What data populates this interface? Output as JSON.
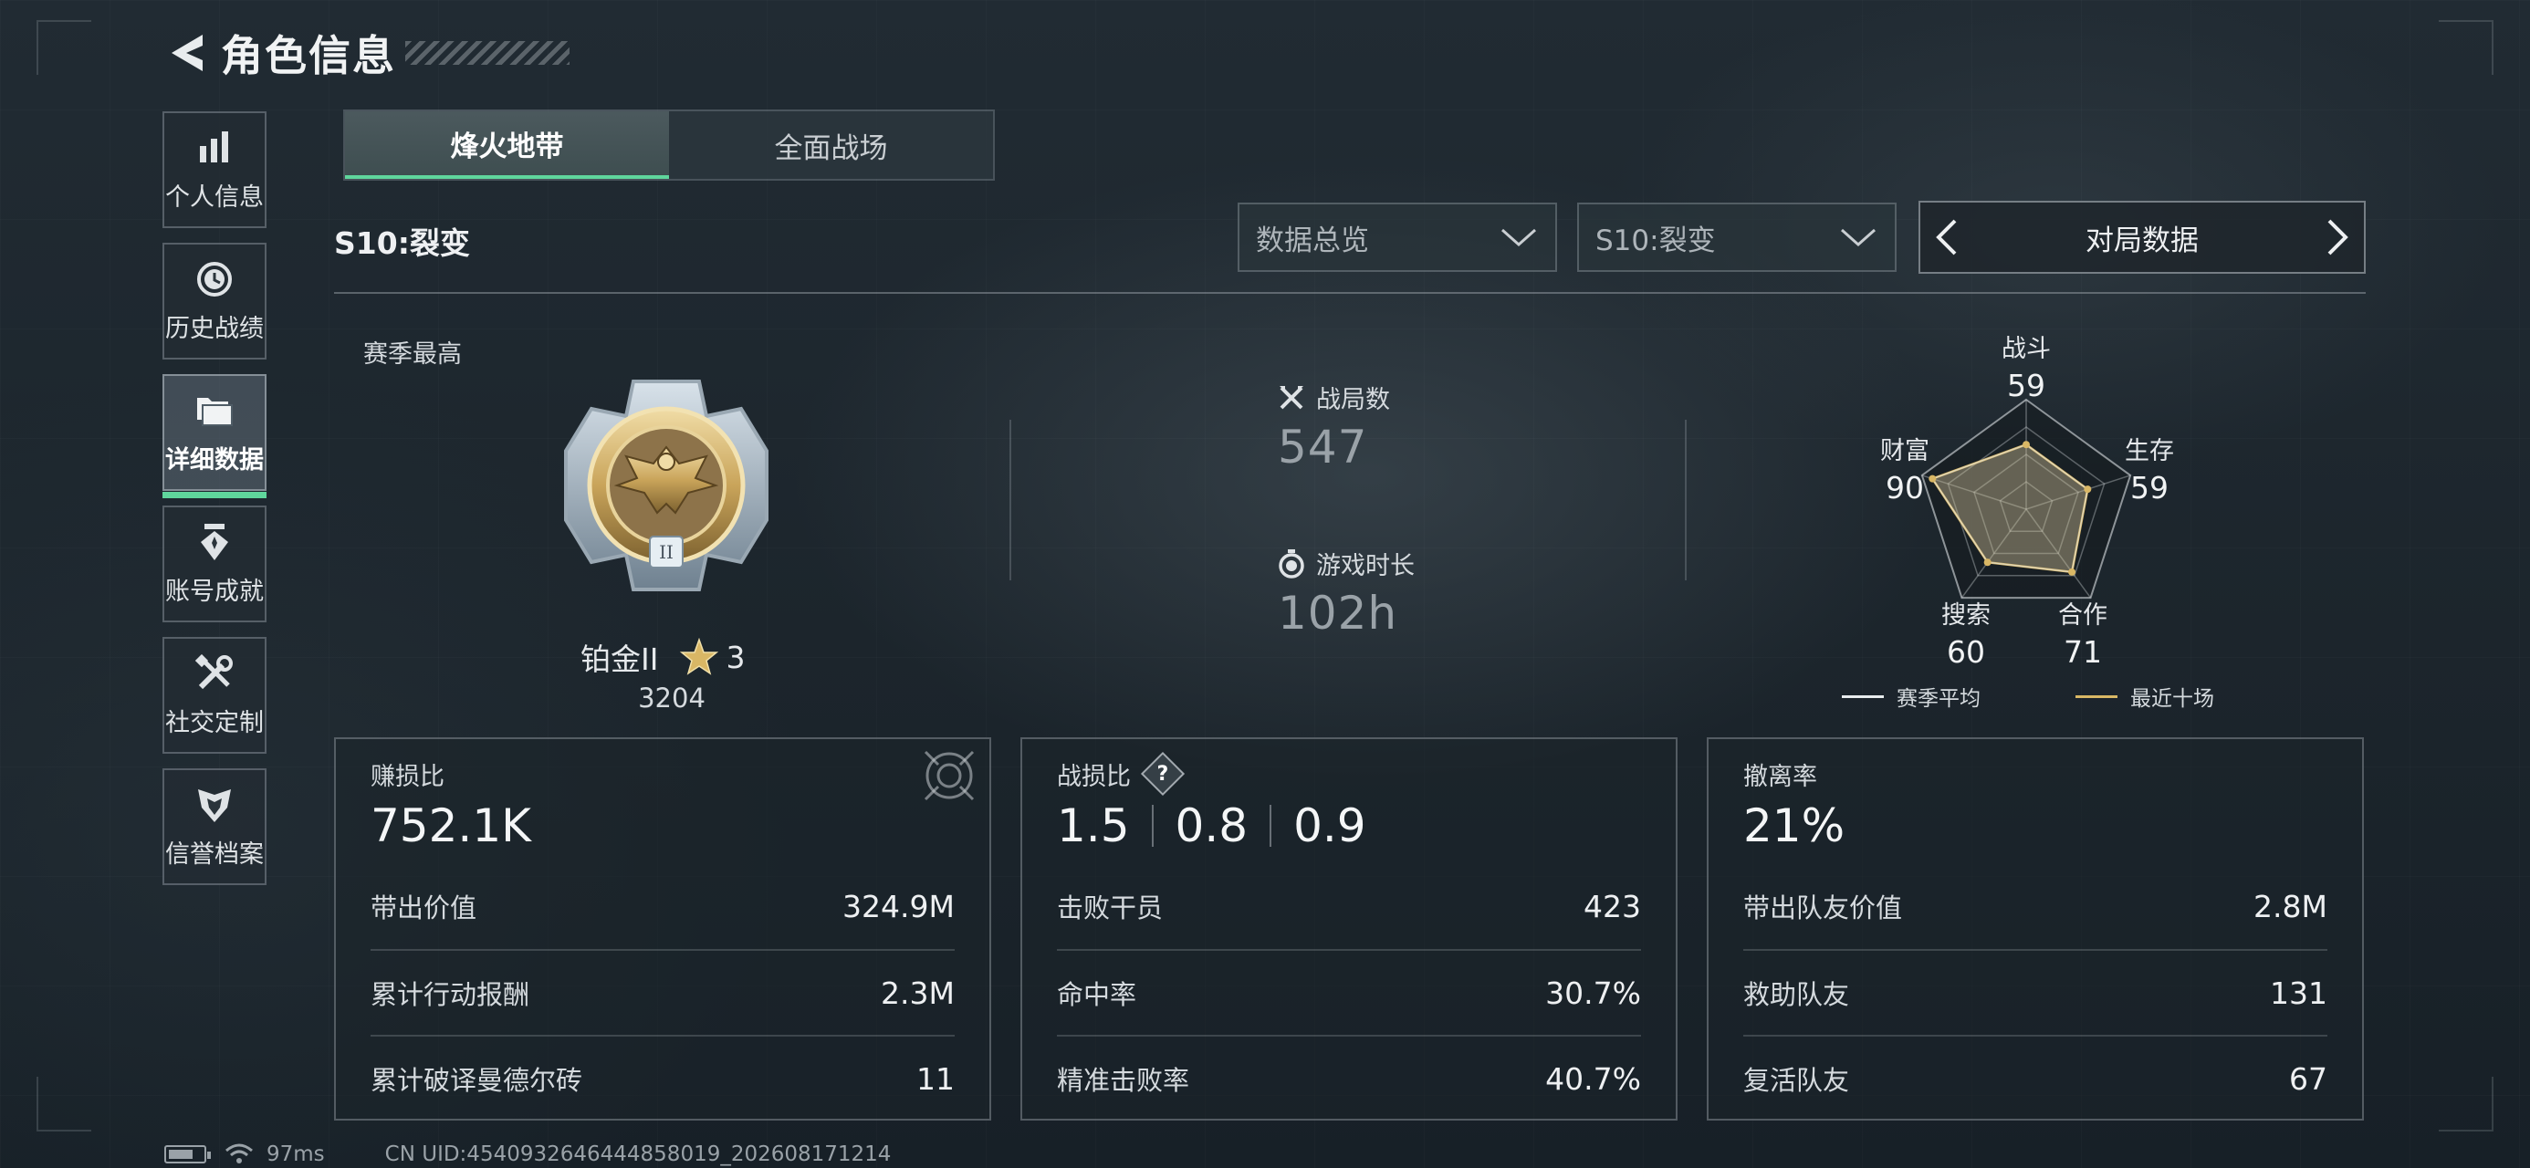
{
  "header": {
    "title": "角色信息"
  },
  "sidebar": {
    "items": [
      {
        "label": "个人信息",
        "icon": "bar-chart-icon"
      },
      {
        "label": "历史战绩",
        "icon": "history-clock-icon"
      },
      {
        "label": "详细数据",
        "icon": "folder-icon",
        "active": true
      },
      {
        "label": "账号成就",
        "icon": "achievement-icon"
      },
      {
        "label": "社交定制",
        "icon": "tools-icon"
      },
      {
        "label": "信誉档案",
        "icon": "shield-wing-icon"
      }
    ]
  },
  "tabs": [
    {
      "label": "烽火地带",
      "active": true
    },
    {
      "label": "全面战场",
      "active": false
    }
  ],
  "filters": {
    "season_title": "S10:裂变",
    "view_dropdown": "数据总览",
    "season_dropdown": "S10:裂变",
    "pager_label": "对局数据"
  },
  "summary": {
    "season_best_label": "赛季最高",
    "rank_name": "铂金II",
    "rank_stars": "3",
    "rank_score": "3204",
    "matches_label": "战局数",
    "matches_value": "547",
    "playtime_label": "游戏时长",
    "playtime_value": "102h"
  },
  "radar": {
    "axes": [
      {
        "name": "战斗",
        "value": 59
      },
      {
        "name": "生存",
        "value": 59
      },
      {
        "name": "合作",
        "value": 71
      },
      {
        "name": "搜索",
        "value": 60
      },
      {
        "name": "财富",
        "value": 90
      }
    ],
    "legend": {
      "season_avg": "赛季平均",
      "recent_ten": "最近十场"
    },
    "colors": {
      "season_avg": "#e8ecee",
      "recent_ten": "#d9b765"
    }
  },
  "cards": {
    "profit": {
      "title": "赚损比",
      "big": "752.1K",
      "rows": [
        {
          "label": "带出价值",
          "value": "324.9M"
        },
        {
          "label": "累计行动报酬",
          "value": "2.3M"
        },
        {
          "label": "累计破译曼德尔砖",
          "value": "11"
        }
      ]
    },
    "combat": {
      "title": "战损比",
      "help": "?",
      "big": [
        "1.5",
        "0.8",
        "0.9"
      ],
      "rows": [
        {
          "label": "击败干员",
          "value": "423"
        },
        {
          "label": "命中率",
          "value": "30.7%"
        },
        {
          "label": "精准击败率",
          "value": "40.7%"
        }
      ]
    },
    "extract": {
      "title": "撤离率",
      "big": "21%",
      "rows": [
        {
          "label": "带出队友价值",
          "value": "2.8M"
        },
        {
          "label": "救助队友",
          "value": "131"
        },
        {
          "label": "复活队友",
          "value": "67"
        }
      ]
    }
  },
  "footer": {
    "ping": "97ms",
    "uid": "CN UID:4540932646444858019_202608171214"
  },
  "colors": {
    "accent": "#5fd69c",
    "gold": "#d9b765"
  }
}
